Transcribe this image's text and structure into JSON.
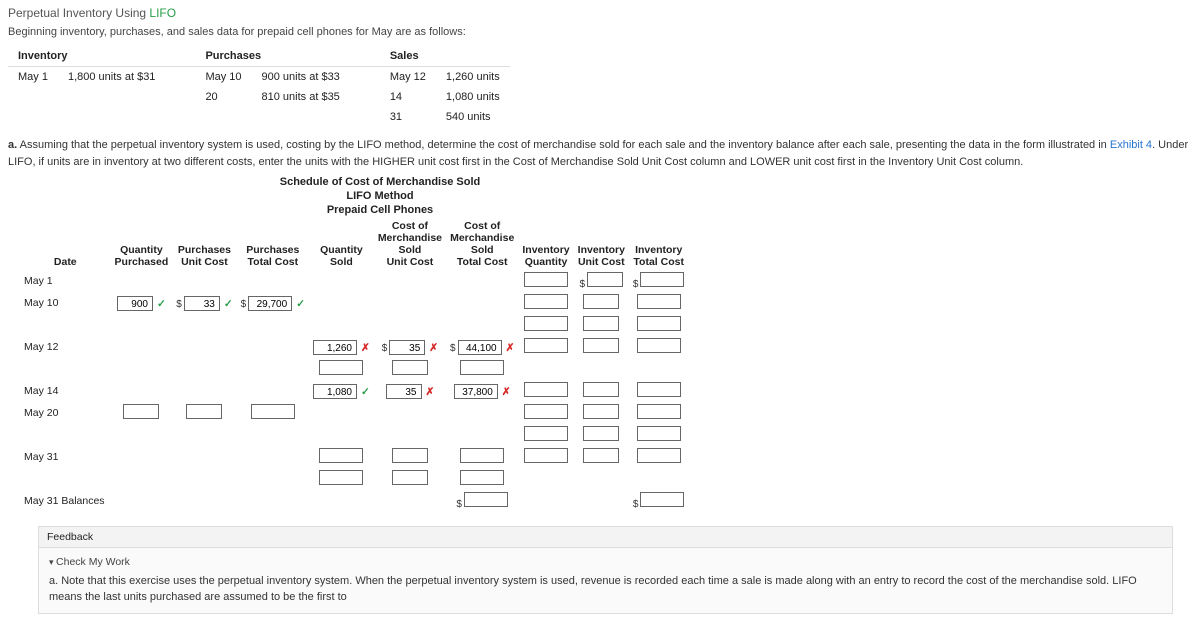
{
  "title": {
    "p1": "Perpetual Inventory Using ",
    "p2": "LIFO"
  },
  "intro": "Beginning inventory, purchases, and sales data for prepaid cell phones for May are as follows:",
  "top": {
    "h_inv": "Inventory",
    "h_pur": "Purchases",
    "h_sal": "Sales",
    "inv_date": "May 1",
    "inv_txt": "1,800 units at $31",
    "pur1_date": "May 10",
    "pur1_txt": "900 units at $33",
    "pur2_date": "20",
    "pur2_txt": "810 units at $35",
    "sal1_date": "May 12",
    "sal1_txt": "1,260 units",
    "sal2_date": "14",
    "sal2_txt": "1,080 units",
    "sal3_date": "31",
    "sal3_txt": "540 units"
  },
  "instr": {
    "a_label": "a.",
    "text1": " Assuming that the perpetual inventory system is used, costing by the LIFO method, determine the cost of merchandise sold for each sale and the inventory balance after each sale, presenting the data in the form illustrated in ",
    "link": "Exhibit 4",
    "text2": ". Under LIFO, if units are in inventory at two different costs, enter the units with the HIGHER unit cost first in the Cost of Merchandise Sold Unit Cost column and LOWER unit cost first in the Inventory Unit Cost column."
  },
  "sched": {
    "h1": "Schedule of Cost of Merchandise Sold",
    "h2": "LIFO Method",
    "h3": "Prepaid Cell Phones",
    "cols": {
      "date": "Date",
      "qp": "Quantity\nPurchased",
      "puc": "Purchases\nUnit Cost",
      "ptc": "Purchases\nTotal Cost",
      "qs": "Quantity\nSold",
      "cmsuc": "Cost of\nMerchandise\nSold\nUnit Cost",
      "cmstc": "Cost of\nMerchandise\nSold\nTotal Cost",
      "iq": "Inventory\nQuantity",
      "iuc": "Inventory\nUnit Cost",
      "itc": "Inventory\nTotal Cost"
    },
    "rows": {
      "may1": "May 1",
      "may10": "May 10",
      "may12": "May 12",
      "may14": "May 14",
      "may20": "May 20",
      "may31": "May 31",
      "bal": "May 31  Balances"
    },
    "vals": {
      "m10_qp": "900",
      "m10_puc": "33",
      "m10_ptc": "29,700",
      "m12_qs": "1,260",
      "m12_uc": "35",
      "m12_tc": "44,100",
      "m14_qs": "1,080",
      "m14_uc": "35",
      "m14_tc": "37,800"
    }
  },
  "fb": {
    "tab": "Feedback",
    "toggle": "Check My Work",
    "note": "a. Note that this exercise uses the perpetual inventory system. When the perpetual inventory system is used, revenue is recorded each time a sale is made along with an entry to record the cost of the merchandise sold. LIFO means the last units purchased are assumed to be the first to"
  },
  "sym": {
    "ok": "✓",
    "bad": "✗",
    "dollar": "$"
  },
  "chart_data": {
    "type": "table",
    "title": "Schedule of Cost of Merchandise Sold — LIFO — Prepaid Cell Phones",
    "columns": [
      "Date",
      "Quantity Purchased",
      "Purchases Unit Cost",
      "Purchases Total Cost",
      "Quantity Sold",
      "COGS Unit Cost",
      "COGS Total Cost",
      "Inventory Quantity",
      "Inventory Unit Cost",
      "Inventory Total Cost"
    ],
    "rows": [
      {
        "Date": "May 1"
      },
      {
        "Date": "May 10",
        "Quantity Purchased": 900,
        "Purchases Unit Cost": 33,
        "Purchases Total Cost": 29700
      },
      {
        "Date": "May 12",
        "Quantity Sold": 1260,
        "COGS Unit Cost": 35,
        "COGS Total Cost": 44100
      },
      {
        "Date": "May 14",
        "Quantity Sold": 1080,
        "COGS Unit Cost": 35,
        "COGS Total Cost": 37800
      },
      {
        "Date": "May 20"
      },
      {
        "Date": "May 31"
      },
      {
        "Date": "May 31 Balances"
      }
    ],
    "given": {
      "beginning_inventory": {
        "date": "May 1",
        "units": 1800,
        "unit_cost": 31
      },
      "purchases": [
        {
          "date": "May 10",
          "units": 900,
          "unit_cost": 33
        },
        {
          "date": "May 20",
          "units": 810,
          "unit_cost": 35
        }
      ],
      "sales": [
        {
          "date": "May 12",
          "units": 1260
        },
        {
          "date": "May 14",
          "units": 1080
        },
        {
          "date": "May 31",
          "units": 540
        }
      ]
    }
  }
}
